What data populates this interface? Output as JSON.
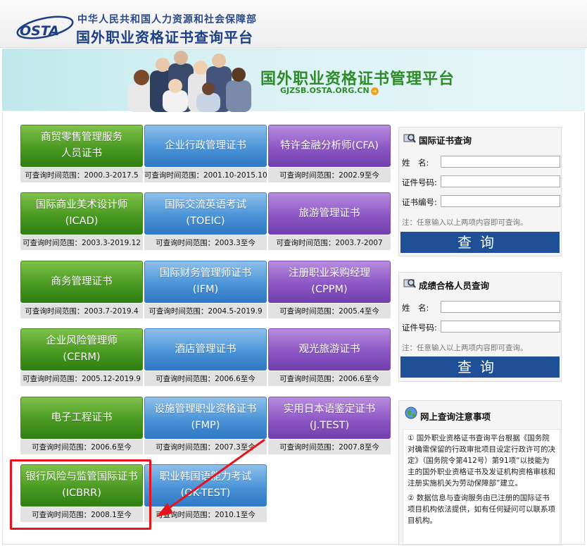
{
  "header": {
    "ministry": "中华人民共和国人力资源和社会保障部",
    "site_name": "国外职业资格证书查询平台",
    "logo_text": "OSTA"
  },
  "banner": {
    "title": "国外职业资格证书管理平台",
    "url": "GJZSB.OSTA.ORG.CN"
  },
  "certificates": [
    {
      "name": "商贸零售管理服务\n人员证书",
      "range": "可查询时间范围：2000.3-2017.5",
      "color": "green"
    },
    {
      "name": "企业行政管理证书",
      "range": "可查询时间范围：2001.10-2015.10",
      "color": "blue"
    },
    {
      "name": "特许金融分析师(CFA)",
      "range": "可查询时间范围：2002.9至今",
      "color": "purple"
    },
    {
      "name": "国际商业美术设计师\n(ICAD)",
      "range": "可查询时间范围：2003.3-2019.12",
      "color": "green"
    },
    {
      "name": "国际交流英语考试\n(TOEIC)",
      "range": "可查询时间范围：2003.3至今",
      "color": "blue"
    },
    {
      "name": "旅游管理证书",
      "range": "可查询时间范围：2003.7-2007",
      "color": "purple"
    },
    {
      "name": "商务管理证书",
      "range": "可查询时间范围：2003.7-2019.4",
      "color": "green"
    },
    {
      "name": "国际财务管理师证书\n(IFM)",
      "range": "可查询时间范围：2004.5-2019.9",
      "color": "blue"
    },
    {
      "name": "注册职业采购经理\n(CPPM)",
      "range": "可查询时间范围：2005.4至今",
      "color": "purple"
    },
    {
      "name": "企业风险管理师\n(CERM)",
      "range": "可查询时间范围：2005.12-2019.9",
      "color": "green"
    },
    {
      "name": "酒店管理证书",
      "range": "可查询时间范围：2006.6至今",
      "color": "blue"
    },
    {
      "name": "观光旅游证书",
      "range": "可查询时间范围：2006.6至今",
      "color": "purple"
    },
    {
      "name": "电子工程证书",
      "range": "可查询时间范围：2006.6至今",
      "color": "green"
    },
    {
      "name": "设施管理职业资格证书\n(FMP)",
      "range": "可查询时间范围：2007.3至今",
      "color": "blue"
    },
    {
      "name": "实用日本语鉴定证书\n(J.TEST)",
      "range": "可查询时间范围：2007.8至今",
      "color": "purple"
    },
    {
      "name": "银行风险与监管国际证书\n(ICBRR)",
      "range": "可查询时间范围：2008.1至今",
      "color": "green"
    },
    {
      "name": "职业韩国语能力考试\n(OK-TEST)",
      "range": "可查询时间范围：2010.1至今",
      "color": "blue"
    }
  ],
  "cert_query": {
    "title": "国际证书查询",
    "name_label": "姓　名:",
    "id_label": "证件号码:",
    "cert_label": "证书编号:",
    "hint": "注：任意输入以上两项内容即可查询。",
    "button": "查询"
  },
  "score_query": {
    "title": "成绩合格人员查询",
    "name_label": "姓　名:",
    "id_label": "证件号码:",
    "hint": "注：任意输入以上两项内容即可查询。",
    "button": "查询"
  },
  "notice": {
    "title": "网上查询注意事项",
    "item1": "① 国外职业资格证书查询平台根据《国务院对确需保留的行政审批项目设定行政许可的决定》（国务院令第412号）第91项“以技能为主的国外职业资格证书及发证机构资格审核和注册实施机关为劳动保障部”建立。",
    "item2": "② 数据信息与查询服务由已注册的国际证书项目机构依法提供，如有任何疑问可以联系项目机构。"
  }
}
